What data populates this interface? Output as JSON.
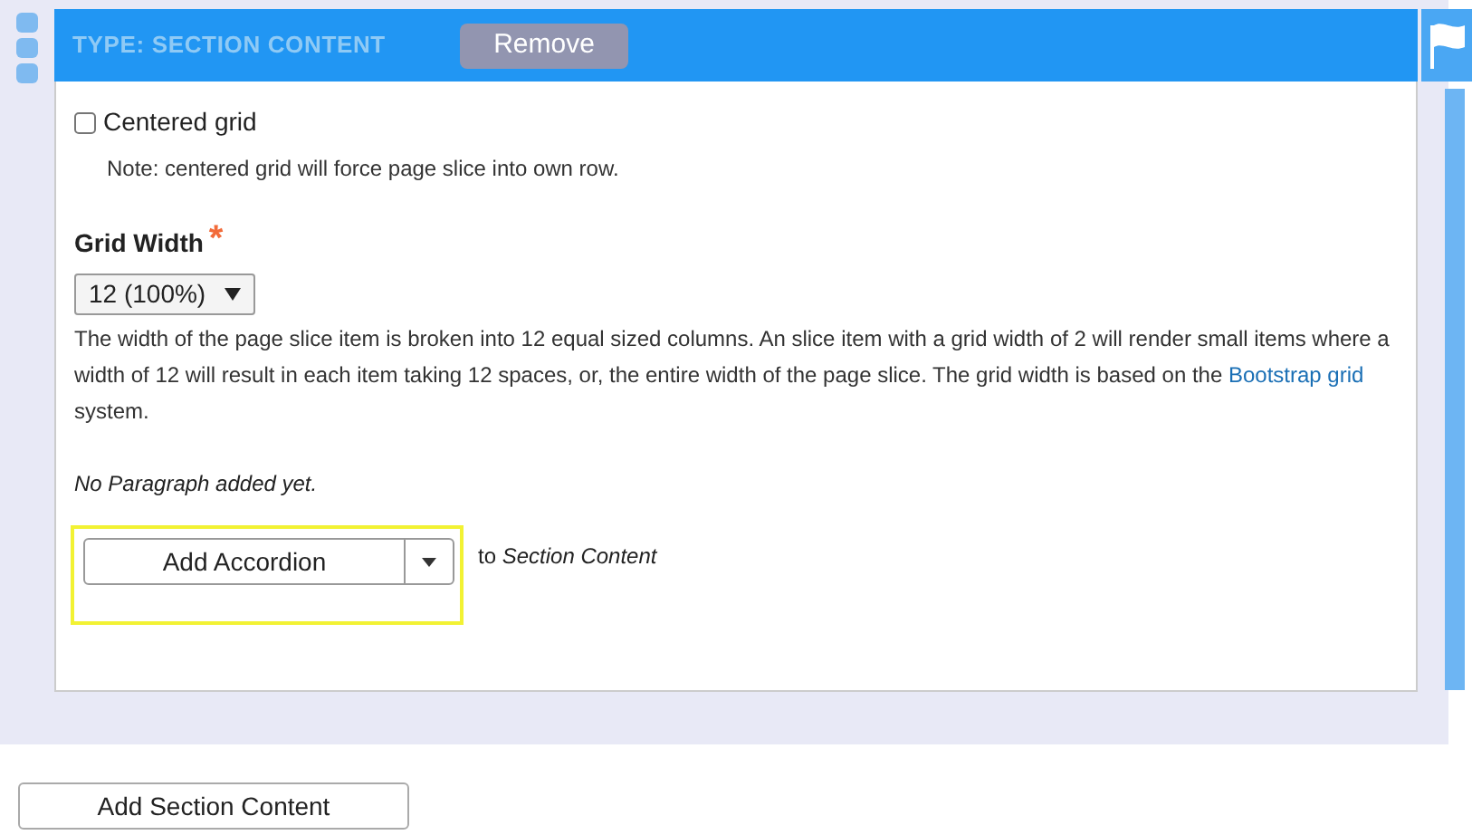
{
  "header": {
    "title": "TYPE: SECTION CONTENT",
    "remove_button": "Remove"
  },
  "centered_grid": {
    "label": "Centered grid",
    "checked": false,
    "note": "Note: centered grid will force page slice into own row."
  },
  "grid_width": {
    "label": "Grid Width",
    "required_mark": "*",
    "value": "12 (100%)",
    "description_before": "The width of the page slice item is broken into 12 equal sized columns. An slice item with a grid width of 2 will render small items where a width of 12 will result in each item taking 12 spaces, or, the entire width of the page slice. The grid width is based on the",
    "link": "Bootstrap grid",
    "description_after": "system."
  },
  "empty_message": "No Paragraph added yet.",
  "add": {
    "button": "Add Accordion",
    "target": "to *Section Content*",
    "highlighted": true
  },
  "footer_button": "Add Section Content"
}
